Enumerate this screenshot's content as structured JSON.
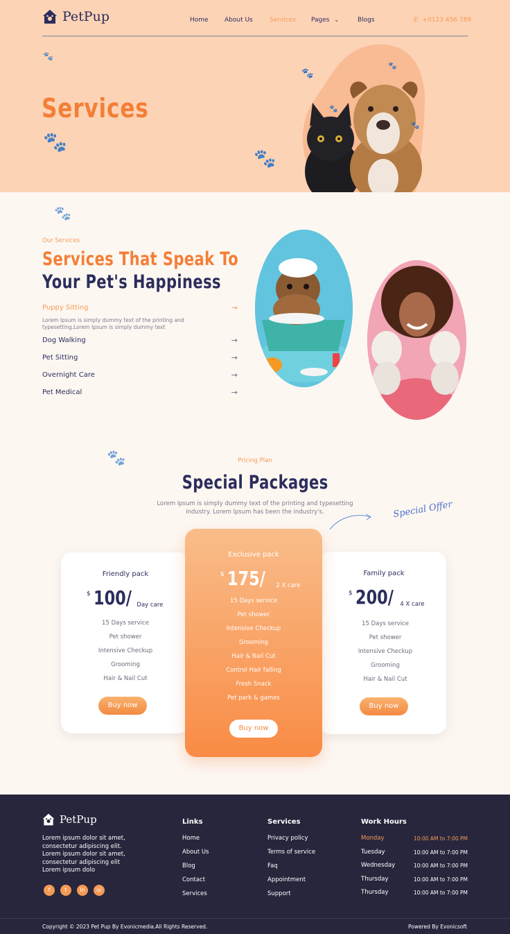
{
  "brand": {
    "name": "PetPup"
  },
  "nav": {
    "home": "Home",
    "about": "About Us",
    "services": "Services",
    "pages": "Pages",
    "blogs": "Blogs",
    "phone": "+0123 456 789"
  },
  "hero": {
    "title": "Services"
  },
  "services": {
    "eyebrow": "Our Services",
    "title_line1": "Services That Speak To",
    "title_line2": "Your Pet's Happiness",
    "active": {
      "label": "Puppy Sitting",
      "desc": "Lorem Ipsum is simply dummy text of the printing and typesetting.Lorem Ipsum is simply dummy text"
    },
    "items": [
      "Dog Walking",
      "Pet Sitting",
      "Overnight Care",
      "Pet Medical"
    ]
  },
  "pricing": {
    "eyebrow": "Pricing Plan",
    "title": "Special Packages",
    "desc_line1": "Lorem Ipsum is simply dummy text of the printing and typesetting",
    "desc_line2": "industry. Lorem Ipsum has been the industry's.",
    "offer": "Special Offer",
    "plans": [
      {
        "name": "Friendly pack",
        "currency": "$",
        "amount": "100/",
        "unit": "Day care",
        "features": [
          "15 Days service",
          "Pet shower",
          "Intensive Checkup",
          "Grooming",
          "Hair & Nail Cut"
        ],
        "button": "Buy now"
      },
      {
        "name": "Exclusive pack",
        "currency": "$",
        "amount": "175/",
        "unit": "2 X care",
        "features": [
          "15 Days service",
          "Pet shower",
          "Intensive Checkup",
          "Grooming",
          "Hair & Nail Cut",
          "Control Hair falling",
          "Fresh Snack",
          "Pet park & games"
        ],
        "button": "Buy now"
      },
      {
        "name": "Family pack",
        "currency": "$",
        "amount": "200/",
        "unit": "4 X care",
        "features": [
          "15 Days service",
          "Pet shower",
          "Intensive Checkup",
          "Grooming",
          "Hair & Nail Cut"
        ],
        "button": "Buy now"
      }
    ]
  },
  "footer": {
    "brand": "PetPup",
    "about": [
      "Lorem ipsum dolor sit amet,",
      "consectetur adipiscing elit.",
      "Lorem ipsum dolor sit amet,",
      "consectetur adipiscing elit",
      "Lorem ipsum dolo"
    ],
    "links_title": "Links",
    "links": [
      "Home",
      "About Us",
      "Blog",
      "Contact",
      "Services"
    ],
    "services_title": "Services",
    "services": [
      "Privacy policy",
      "Terms of service",
      "Faq",
      "Appointment",
      "Support"
    ],
    "hours_title": "Work Hours",
    "hours": [
      {
        "day": "Monday",
        "time": "10:00 AM to 7:00 PM"
      },
      {
        "day": "Tuesday",
        "time": "10:00 AM to 7:00 PM"
      },
      {
        "day": "Wednesday",
        "time": "10:00 AM to 7:00 PM"
      },
      {
        "day": "Thursday",
        "time": "10:00 AM to 7:00 PM"
      },
      {
        "day": "Thursday",
        "time": "10:00 AM to 7:00 PM"
      }
    ],
    "copyright": "Copyright © 2023 Pet Pup By Evonicmedia.All Rights Reserved.",
    "powered": "Powered By Evonicsoft"
  },
  "colors": {
    "accent": "#f37f37",
    "navy": "#2b2d5c",
    "peach": "#fdd3b6",
    "footer": "#27263d"
  }
}
